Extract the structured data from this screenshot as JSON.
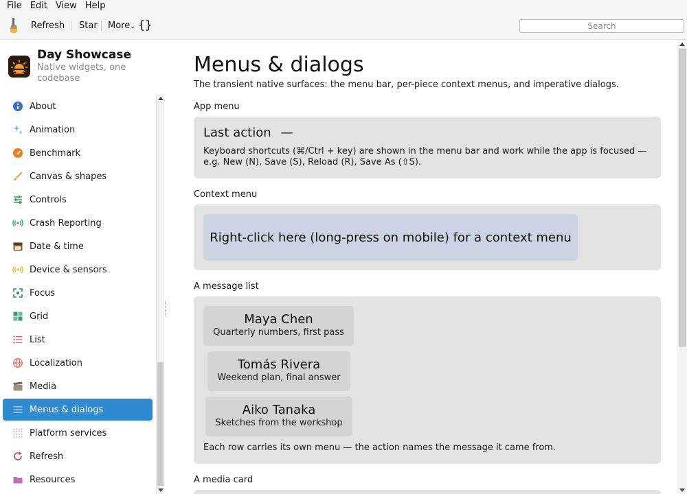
{
  "menubar": {
    "items": [
      "File",
      "Edit",
      "View",
      "Help"
    ]
  },
  "toolbar": {
    "refresh_label": "Refresh",
    "star_label": "Star",
    "more_label": "More",
    "more_indicator": "⌄",
    "braces_label": "{}",
    "search_placeholder": "Search"
  },
  "app": {
    "title": "Day Showcase",
    "subtitle": "Native widgets, one codebase"
  },
  "sidebar": {
    "active_index": 13,
    "items": [
      {
        "label": "About",
        "icon": "info-icon",
        "color": "#3b6fc7"
      },
      {
        "label": "Animation",
        "icon": "sparkle-icon",
        "color": "#6aa9e9"
      },
      {
        "label": "Benchmark",
        "icon": "speedometer-icon",
        "color": "#f07d18"
      },
      {
        "label": "Canvas & shapes",
        "icon": "brush-icon",
        "color": "#f0a04a"
      },
      {
        "label": "Controls",
        "icon": "sliders-icon",
        "color": "#3aa55a"
      },
      {
        "label": "Crash Reporting",
        "icon": "broadcast-icon",
        "color": "#3aa55a"
      },
      {
        "label": "Date & time",
        "icon": "calendar-icon",
        "color": "#8a5a2b"
      },
      {
        "label": "Device & sensors",
        "icon": "sensor-icon",
        "color": "#e0c030"
      },
      {
        "label": "Focus",
        "icon": "focus-icon",
        "color": "#2a8a6a"
      },
      {
        "label": "Grid",
        "icon": "grid-icon",
        "color": "#3a9a7a"
      },
      {
        "label": "List",
        "icon": "list-icon",
        "color": "#e05050"
      },
      {
        "label": "Localization",
        "icon": "globe-icon",
        "color": "#e07060"
      },
      {
        "label": "Media",
        "icon": "clapper-icon",
        "color": "#a09080"
      },
      {
        "label": "Menus & dialogs",
        "icon": "menu-icon",
        "color": "#2e6fb0"
      },
      {
        "label": "Platform services",
        "icon": "dots-grid-icon",
        "color": "#e0a0b0"
      },
      {
        "label": "Refresh",
        "icon": "refresh-icon",
        "color": "#c04060"
      },
      {
        "label": "Resources",
        "icon": "folder-icon",
        "color": "#c070b0"
      }
    ]
  },
  "main": {
    "title": "Menus & dialogs",
    "description": "The transient native surfaces: the menu bar, per-piece context menus, and imperative dialogs.",
    "app_menu": {
      "heading": "App menu",
      "last_action_label": "Last action",
      "last_action_value": "—",
      "shortcut_text": "Keyboard shortcuts (⌘/Ctrl + key) are shown in the menu bar and work while the app is focused — e.g. New (N), Save (S), Reload (R), Save As (⇧S)."
    },
    "context_menu": {
      "heading": "Context menu",
      "target_label": "Right-click here (long-press on mobile) for a context menu"
    },
    "message_list": {
      "heading": "A message list",
      "messages": [
        {
          "name": "Maya Chen",
          "subject": "Quarterly numbers, first pass"
        },
        {
          "name": "Tomás Rivera",
          "subject": "Weekend plan, final answer"
        },
        {
          "name": "Aiko Tanaka",
          "subject": "Sketches from the workshop"
        }
      ],
      "note": "Each row carries its own menu — the action names the message it came from."
    },
    "media_card": {
      "heading": "A media card"
    }
  }
}
